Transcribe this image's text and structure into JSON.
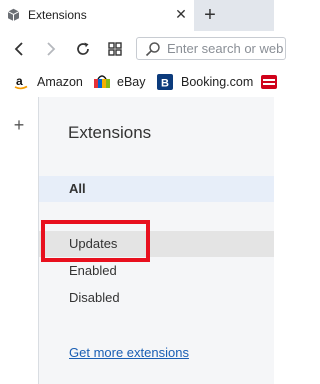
{
  "tab": {
    "title": "Extensions",
    "close_glyph": "✕",
    "new_tab_glyph": "+"
  },
  "toolbar": {
    "search_placeholder": "Enter search or web address"
  },
  "bookmarks": [
    {
      "label": "Amazon",
      "icon": "amazon-icon"
    },
    {
      "label": "eBay",
      "icon": "ebay-icon"
    },
    {
      "label": "Booking.com",
      "icon": "booking-icon"
    },
    {
      "label": "",
      "icon": "red-bookmark-icon"
    }
  ],
  "rail": {
    "add_glyph": "+"
  },
  "panel": {
    "title": "Extensions",
    "nav": {
      "all": "All",
      "updates": "Updates",
      "enabled": "Enabled",
      "disabled": "Disabled"
    },
    "get_more": "Get more extensions"
  },
  "colors": {
    "accent_link": "#1a5fb4",
    "highlight_red": "#e8101e",
    "tabstrip": "#e2e6ec",
    "panel_bg": "#f5f6f8",
    "selected_bg": "#e7eef9"
  }
}
